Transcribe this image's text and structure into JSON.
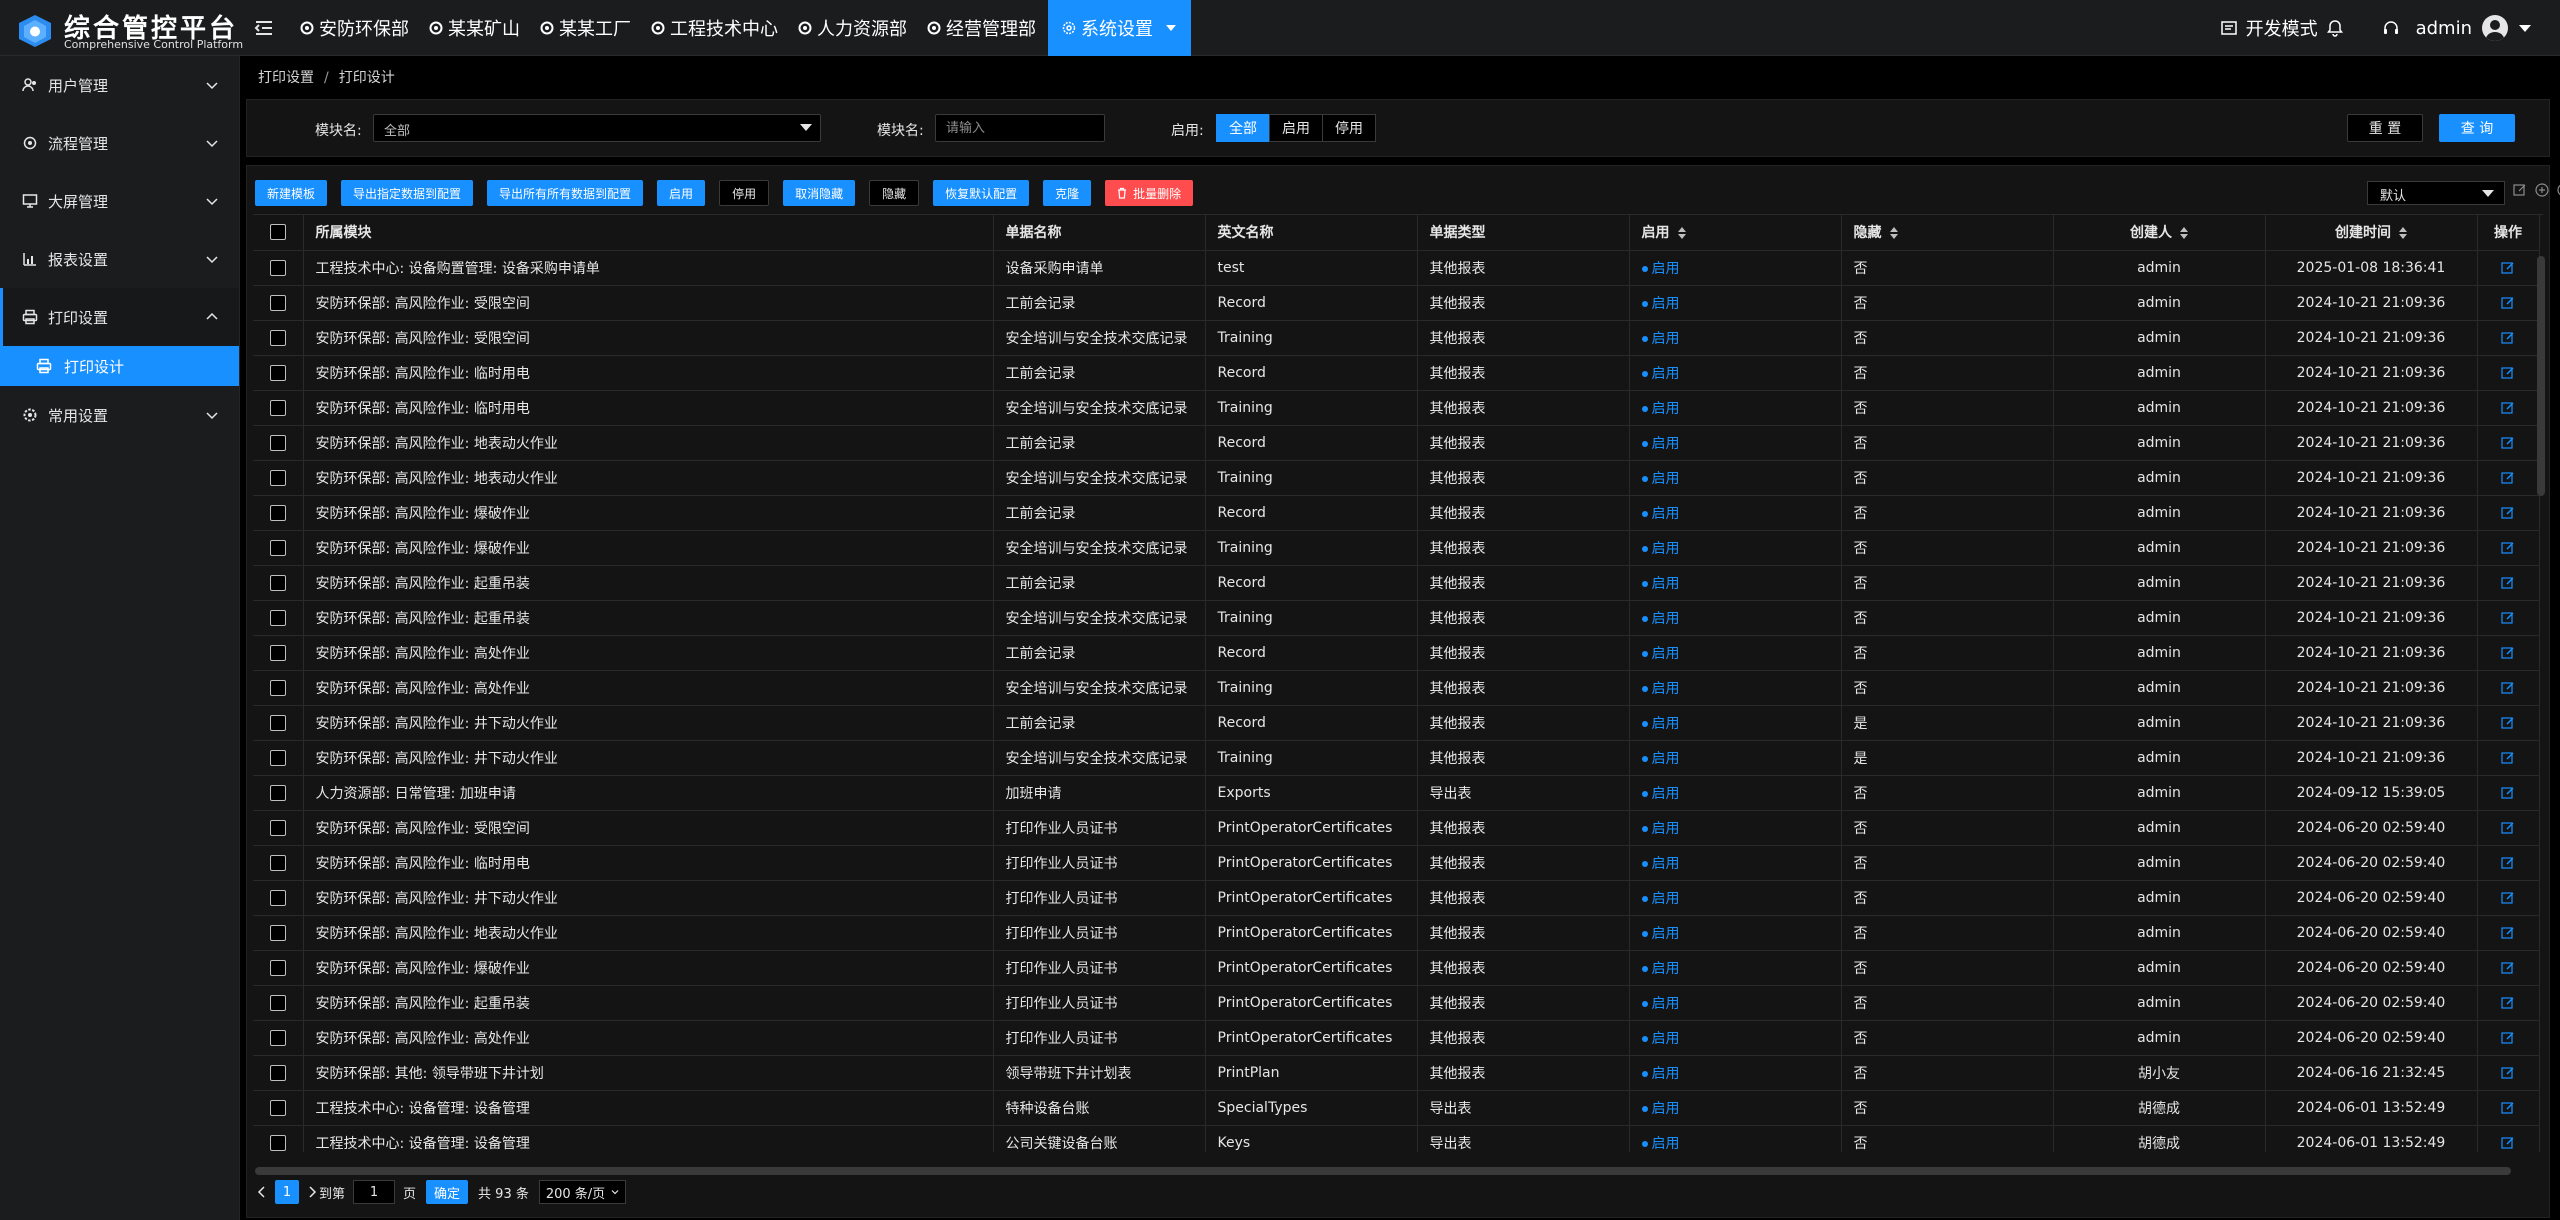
{
  "app": {
    "title": "综合管控平台",
    "subtitle": "Comprehensive Control Platform"
  },
  "topnav": {
    "items": [
      "安防环保部",
      "某某矿山",
      "某某工厂",
      "工程技术中心",
      "人力资源部",
      "经营管理部",
      "系统设置"
    ],
    "active": "系统设置",
    "dev_mode": "开发模式",
    "user": "admin"
  },
  "sidebar": {
    "items": [
      {
        "label": "用户管理",
        "icon": "users-icon"
      },
      {
        "label": "流程管理",
        "icon": "flow-icon"
      },
      {
        "label": "大屏管理",
        "icon": "screen-icon"
      },
      {
        "label": "报表设置",
        "icon": "report-icon"
      },
      {
        "label": "打印设置",
        "icon": "printer-icon"
      },
      {
        "label": "常用设置",
        "icon": "gear-icon"
      }
    ],
    "sub_active": "打印设计"
  },
  "breadcrumb": [
    "打印设置",
    "打印设计"
  ],
  "filter": {
    "module_label": "模块名:",
    "module_value": "全部",
    "block_label": "模块名:",
    "block_placeholder": "请输入",
    "enable_label": "启用:",
    "enable_options": [
      "全部",
      "启用",
      "停用"
    ],
    "enable_selected": "全部",
    "reset": "重 置",
    "query": "查 询"
  },
  "toolbar": {
    "buttons": [
      "新建模板",
      "导出指定数据到配置",
      "导出所有所有数据到配置",
      "启用",
      "停用",
      "取消隐藏",
      "隐藏",
      "恢复默认配置",
      "克隆",
      "批量删除"
    ],
    "view": "默认"
  },
  "table": {
    "headers": [
      "所属模块",
      "单据名称",
      "英文名称",
      "单据类型",
      "启用",
      "隐藏",
      "创建人",
      "创建时间",
      "操作"
    ],
    "rows": [
      [
        "工程技术中心: 设备购置管理: 设备采购申请单",
        "设备采购申请单",
        "test",
        "其他报表",
        "启用",
        "否",
        "admin",
        "2025-01-08 18:36:41"
      ],
      [
        "安防环保部: 高风险作业: 受限空间",
        "工前会记录",
        "Record",
        "其他报表",
        "启用",
        "否",
        "admin",
        "2024-10-21 21:09:36"
      ],
      [
        "安防环保部: 高风险作业: 受限空间",
        "安全培训与安全技术交底记录",
        "Training",
        "其他报表",
        "启用",
        "否",
        "admin",
        "2024-10-21 21:09:36"
      ],
      [
        "安防环保部: 高风险作业: 临时用电",
        "工前会记录",
        "Record",
        "其他报表",
        "启用",
        "否",
        "admin",
        "2024-10-21 21:09:36"
      ],
      [
        "安防环保部: 高风险作业: 临时用电",
        "安全培训与安全技术交底记录",
        "Training",
        "其他报表",
        "启用",
        "否",
        "admin",
        "2024-10-21 21:09:36"
      ],
      [
        "安防环保部: 高风险作业: 地表动火作业",
        "工前会记录",
        "Record",
        "其他报表",
        "启用",
        "否",
        "admin",
        "2024-10-21 21:09:36"
      ],
      [
        "安防环保部: 高风险作业: 地表动火作业",
        "安全培训与安全技术交底记录",
        "Training",
        "其他报表",
        "启用",
        "否",
        "admin",
        "2024-10-21 21:09:36"
      ],
      [
        "安防环保部: 高风险作业: 爆破作业",
        "工前会记录",
        "Record",
        "其他报表",
        "启用",
        "否",
        "admin",
        "2024-10-21 21:09:36"
      ],
      [
        "安防环保部: 高风险作业: 爆破作业",
        "安全培训与安全技术交底记录",
        "Training",
        "其他报表",
        "启用",
        "否",
        "admin",
        "2024-10-21 21:09:36"
      ],
      [
        "安防环保部: 高风险作业: 起重吊装",
        "工前会记录",
        "Record",
        "其他报表",
        "启用",
        "否",
        "admin",
        "2024-10-21 21:09:36"
      ],
      [
        "安防环保部: 高风险作业: 起重吊装",
        "安全培训与安全技术交底记录",
        "Training",
        "其他报表",
        "启用",
        "否",
        "admin",
        "2024-10-21 21:09:36"
      ],
      [
        "安防环保部: 高风险作业: 高处作业",
        "工前会记录",
        "Record",
        "其他报表",
        "启用",
        "否",
        "admin",
        "2024-10-21 21:09:36"
      ],
      [
        "安防环保部: 高风险作业: 高处作业",
        "安全培训与安全技术交底记录",
        "Training",
        "其他报表",
        "启用",
        "否",
        "admin",
        "2024-10-21 21:09:36"
      ],
      [
        "安防环保部: 高风险作业: 井下动火作业",
        "工前会记录",
        "Record",
        "其他报表",
        "启用",
        "是",
        "admin",
        "2024-10-21 21:09:36"
      ],
      [
        "安防环保部: 高风险作业: 井下动火作业",
        "安全培训与安全技术交底记录",
        "Training",
        "其他报表",
        "启用",
        "是",
        "admin",
        "2024-10-21 21:09:36"
      ],
      [
        "人力资源部: 日常管理: 加班申请",
        "加班申请",
        "Exports",
        "导出表",
        "启用",
        "否",
        "admin",
        "2024-09-12 15:39:05"
      ],
      [
        "安防环保部: 高风险作业: 受限空间",
        "打印作业人员证书",
        "PrintOperatorCertificates",
        "其他报表",
        "启用",
        "否",
        "admin",
        "2024-06-20 02:59:40"
      ],
      [
        "安防环保部: 高风险作业: 临时用电",
        "打印作业人员证书",
        "PrintOperatorCertificates",
        "其他报表",
        "启用",
        "否",
        "admin",
        "2024-06-20 02:59:40"
      ],
      [
        "安防环保部: 高风险作业: 井下动火作业",
        "打印作业人员证书",
        "PrintOperatorCertificates",
        "其他报表",
        "启用",
        "否",
        "admin",
        "2024-06-20 02:59:40"
      ],
      [
        "安防环保部: 高风险作业: 地表动火作业",
        "打印作业人员证书",
        "PrintOperatorCertificates",
        "其他报表",
        "启用",
        "否",
        "admin",
        "2024-06-20 02:59:40"
      ],
      [
        "安防环保部: 高风险作业: 爆破作业",
        "打印作业人员证书",
        "PrintOperatorCertificates",
        "其他报表",
        "启用",
        "否",
        "admin",
        "2024-06-20 02:59:40"
      ],
      [
        "安防环保部: 高风险作业: 起重吊装",
        "打印作业人员证书",
        "PrintOperatorCertificates",
        "其他报表",
        "启用",
        "否",
        "admin",
        "2024-06-20 02:59:40"
      ],
      [
        "安防环保部: 高风险作业: 高处作业",
        "打印作业人员证书",
        "PrintOperatorCertificates",
        "其他报表",
        "启用",
        "否",
        "admin",
        "2024-06-20 02:59:40"
      ],
      [
        "安防环保部: 其他: 领导带班下井计划",
        "领导带班下井计划表",
        "PrintPlan",
        "其他报表",
        "启用",
        "否",
        "胡小友",
        "2024-06-16 21:32:45"
      ],
      [
        "工程技术中心: 设备管理: 设备管理",
        "特种设备台账",
        "SpecialTypes",
        "导出表",
        "启用",
        "否",
        "胡德成",
        "2024-06-01 13:52:49"
      ],
      [
        "工程技术中心: 设备管理: 设备管理",
        "公司关键设备台账",
        "Keys",
        "导出表",
        "启用",
        "否",
        "胡德成",
        "2024-06-01 13:52:49"
      ]
    ]
  },
  "pager": {
    "current": "1",
    "goto_label": "到第",
    "goto_value": "1",
    "page_unit": "页",
    "confirm": "确定",
    "total": "共 93 条",
    "page_size": "200 条/页"
  },
  "colors": {
    "accent": "#1890ff",
    "danger": "#ff4d4f",
    "bg": "#000000",
    "panel": "#1b1c1e"
  }
}
